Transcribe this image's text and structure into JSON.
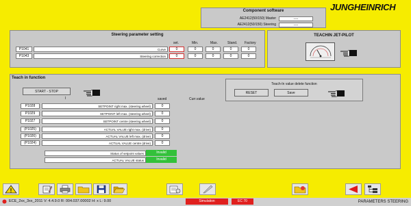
{
  "brand": {
    "logo_text": "JUNGHEINRICH"
  },
  "component_software": {
    "title": "Component software",
    "rows": [
      {
        "label": "AE2412(50/150) Master",
        "value": "----"
      },
      {
        "label": "AE2412(50/150) Steering",
        "value": "----"
      }
    ]
  },
  "steering": {
    "title": "Steering parameter setting",
    "columns": [
      "set.",
      "Min.",
      "Max.",
      "Stand.",
      "Factory"
    ],
    "rows": [
      {
        "code": "P1041",
        "name": "Curve",
        "values": [
          "0",
          "0",
          "0",
          "0",
          "0"
        ]
      },
      {
        "code": "P1043",
        "name": "Steering correction",
        "values": [
          "0",
          "0",
          "0",
          "0",
          "0"
        ]
      }
    ]
  },
  "teachin_jet": {
    "title": "TEACHIN JET-PILOT"
  },
  "teach_in": {
    "title": "Teach in function",
    "start_stop_label": "START - STOP",
    "col_i": "I",
    "col_saved": "saved",
    "col_curr": "Curr.value",
    "delete_title": "Teach-In value delete function",
    "reset_label": "RESET",
    "save_label": "Save",
    "rows": [
      {
        "code": "P1028",
        "name": "SETPOINT right max. (steering wheel)",
        "saved": "0"
      },
      {
        "code": "P1029",
        "name": "SETPOINT left max. (steering wheel)",
        "saved": "0"
      },
      {
        "code": "P1027",
        "name": "SETPOINT centre (steering wheel)",
        "saved": "0"
      },
      {
        "code": "(P1025)",
        "name": "ACTUAL VALUE right max. (drive)",
        "saved": "0"
      },
      {
        "code": "(P1026)",
        "name": "ACTUAL VALUE left max. (drive)",
        "saved": "0"
      },
      {
        "code": "(P1024)",
        "name": "ACTUAL VALUE centre (drive)",
        "saved": "0"
      }
    ],
    "status": [
      {
        "label": "Status of setpoint values",
        "value": "Invalid"
      },
      {
        "label": "ACTUAL VALUE status",
        "value": "Invalid"
      }
    ]
  },
  "toolbar": {
    "icons": [
      "warning-icon",
      "edit-icon",
      "print-icon",
      "folder-icon",
      "save-icon",
      "folder-open-icon",
      "parameters-icon",
      "pen-icon",
      "folder-alert-icon",
      "back-arrow-icon",
      "tree-icon"
    ]
  },
  "statusbar": {
    "version_text": "ECE_2xx_3xx_2011  V: 4.4.9.0  R: 004.037.00002  H: x  L: 9.00",
    "simulation": "Simulation",
    "ec": "EC 70",
    "screen_name": "PARAMETERS STEERING"
  },
  "colors": {
    "background": "#f6ec00",
    "panel": "#c9c9c9",
    "invalid": "#33c13a",
    "statusbar_red": "#e0201e"
  }
}
